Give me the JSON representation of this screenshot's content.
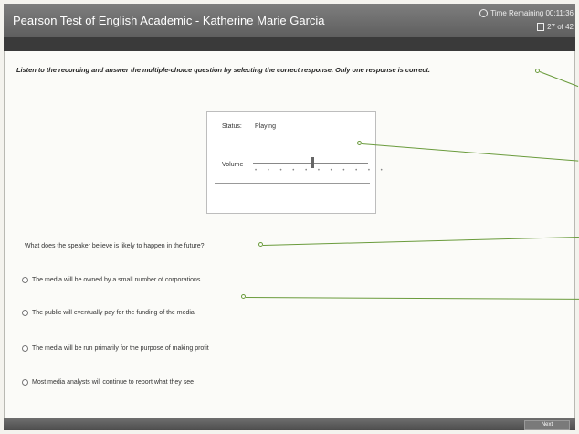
{
  "header": {
    "title": "Pearson Test of English Academic - Katherine Marie Garcia",
    "timer_label": "Time Remaining 00:11:36",
    "question_count": "27 of 42"
  },
  "instruction": "Listen to the recording and answer the multiple-choice question by selecting the correct response. Only one response is correct.",
  "audio_player": {
    "status_label": "Status:",
    "status_value": "Playing",
    "volume_label": "Volume",
    "volume_level": 0.55
  },
  "question": {
    "text": "What does the speaker believe is likely to happen in the future?"
  },
  "options": [
    {
      "label": "The media will be owned by a small number of corporations"
    },
    {
      "label": "The public will eventually pay for the funding of the media"
    },
    {
      "label": "The media will be run primarily for the purpose of making profit"
    },
    {
      "label": "Most media analysts will continue to report what they see"
    }
  ],
  "footer": {
    "next_label": "Next"
  },
  "colors": {
    "titlebar": "#6e6e6e",
    "callout": "#6a9b3c"
  }
}
